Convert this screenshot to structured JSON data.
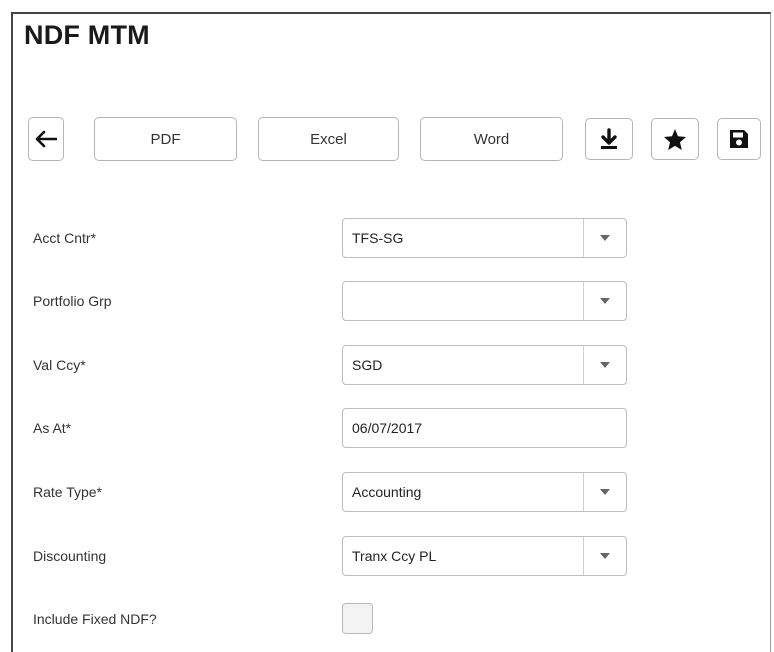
{
  "page": {
    "title": "NDF MTM"
  },
  "toolbar": {
    "back_icon": "arrow-left-icon",
    "pdf_label": "PDF",
    "excel_label": "Excel",
    "word_label": "Word",
    "download_icon": "download-icon",
    "favorite_icon": "star-icon",
    "save_icon": "floppy-disk-icon"
  },
  "form": {
    "acct_cntr": {
      "label": "Acct Cntr*",
      "value": "TFS-SG"
    },
    "portfolio_grp": {
      "label": "Portfolio Grp",
      "value": ""
    },
    "val_ccy": {
      "label": "Val Ccy*",
      "value": "SGD"
    },
    "as_at": {
      "label": "As At*",
      "value": "06/07/2017"
    },
    "rate_type": {
      "label": "Rate Type*",
      "value": "Accounting"
    },
    "discounting": {
      "label": "Discounting",
      "value": "Tranx Ccy PL"
    },
    "include_fixed_ndf": {
      "label": "Include Fixed NDF?",
      "checked": false
    }
  },
  "colors": {
    "border": "#b5b5b5",
    "text": "#222222",
    "arrow": "#666666"
  }
}
